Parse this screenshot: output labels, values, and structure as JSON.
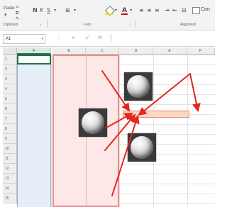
{
  "ribbon": {
    "paste_label": "Paste",
    "clipboard_label": "Clipboard",
    "font_label": "Font",
    "alignment_label": "Alignment",
    "wrap_label": "Con",
    "icons": [
      "bold-icon",
      "italic-icon",
      "underline-icon",
      "borders-icon",
      "fill-color-icon",
      "font-color-icon",
      "align-left-icon",
      "align-center-icon",
      "align-right-icon",
      "indent-icon",
      "outdent-icon",
      "merge-icon",
      "wrap-text-icon"
    ]
  },
  "formula_bar": {
    "name_box": "A1",
    "cancel_glyph": "×",
    "enter_glyph": "✓",
    "fx_glyph": "fx"
  },
  "grid": {
    "columns": [
      "A",
      "B",
      "C",
      "D",
      "E",
      "F"
    ],
    "rows": [
      "1",
      "2",
      "3",
      "4",
      "5",
      "6",
      "7",
      "8",
      "9",
      "10",
      "11",
      "12",
      "13",
      "14",
      "15"
    ],
    "selected_column": "A",
    "active_cell": "A1"
  },
  "annotations": {
    "arrow_color": "#e3261e",
    "band_color": "#fde7e7",
    "band_border": "#f08c8c",
    "knob_icon": "rotary-knob-icon"
  }
}
